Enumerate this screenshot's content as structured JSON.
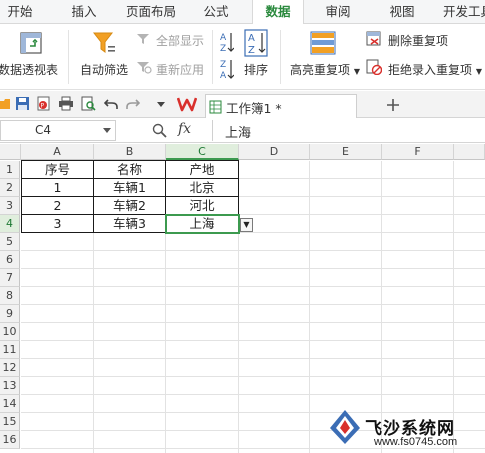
{
  "ribbon_tabs": [
    "开始",
    "插入",
    "页面布局",
    "公式",
    "数据",
    "审阅",
    "视图",
    "开发工具"
  ],
  "active_tab": "数据",
  "ribbon": {
    "pivot_label": "数据透视表",
    "autofilter_label": "自动筛选",
    "show_all_label": "全部显示",
    "reapply_label": "重新应用",
    "sort_label": "排序",
    "highlight_dup_label": "高亮重复项",
    "remove_dup_label": "删除重复项",
    "reject_dup_label": "拒绝录入重复项"
  },
  "document": {
    "tab_label": "工作簿1 *"
  },
  "formula_bar": {
    "name_box": "C4",
    "fx_label": "fx",
    "value": "上海"
  },
  "sheet": {
    "columns": [
      "A",
      "B",
      "C",
      "D",
      "E",
      "F"
    ],
    "rows": [
      "1",
      "2",
      "3",
      "4",
      "5",
      "6",
      "7",
      "8",
      "9",
      "10",
      "11",
      "12",
      "13",
      "14",
      "15",
      "16"
    ],
    "cells": [
      [
        "序号",
        "名称",
        "产地"
      ],
      [
        "1",
        "车辆1",
        "北京"
      ],
      [
        "2",
        "车辆2",
        "河北"
      ],
      [
        "3",
        "车辆3",
        "上海"
      ]
    ],
    "active_cell": "C4"
  },
  "watermark": {
    "title": "飞沙系统网",
    "url": "www.fs0745.com"
  },
  "colors": {
    "accent_green": "#2b8a3e",
    "selection_green": "#3c9a4f",
    "icon_blue": "#3b6db5",
    "icon_orange": "#f2a024",
    "wps_red": "#d9302c"
  }
}
